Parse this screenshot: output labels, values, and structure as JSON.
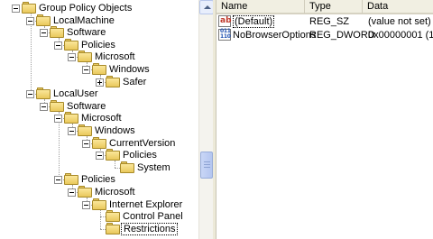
{
  "tree": {
    "nodes": [
      {
        "label": "Group Policy Objects",
        "level": 0,
        "expanded": true
      },
      {
        "label": "LocalMachine",
        "level": 1,
        "expanded": true
      },
      {
        "label": "Software",
        "level": 2,
        "expanded": true
      },
      {
        "label": "Policies",
        "level": 3,
        "expanded": true
      },
      {
        "label": "Microsoft",
        "level": 4,
        "expanded": true
      },
      {
        "label": "Windows",
        "level": 5,
        "expanded": true
      },
      {
        "label": "Safer",
        "level": 6,
        "expanded": false
      },
      {
        "label": "LocalUser",
        "level": 1,
        "expanded": true
      },
      {
        "label": "Software",
        "level": 2,
        "expanded": true
      },
      {
        "label": "Microsoft",
        "level": 3,
        "expanded": true
      },
      {
        "label": "Windows",
        "level": 4,
        "expanded": true
      },
      {
        "label": "CurrentVersion",
        "level": 5,
        "expanded": true
      },
      {
        "label": "Policies",
        "level": 6,
        "expanded": true
      },
      {
        "label": "System",
        "level": 7,
        "expanded": null
      },
      {
        "label": "Policies",
        "level": 3,
        "expanded": true
      },
      {
        "label": "Microsoft",
        "level": 4,
        "expanded": true
      },
      {
        "label": "Internet Explorer",
        "level": 5,
        "expanded": true
      },
      {
        "label": "Control Panel",
        "level": 6,
        "expanded": null
      },
      {
        "label": "Restrictions",
        "level": 6,
        "expanded": null,
        "selected": true
      }
    ]
  },
  "list": {
    "columns": {
      "name": "Name",
      "type": "Type",
      "data": "Data"
    },
    "rows": [
      {
        "icon": "string-value-icon",
        "icon_text": "ab",
        "name": "(Default)",
        "type": "REG_SZ",
        "data": "(value not set)"
      },
      {
        "icon": "binary-value-icon",
        "icon_text": "011 110",
        "name": "NoBrowserOptions",
        "type": "REG_DWORD",
        "data": "0x00000001 (1)"
      }
    ]
  },
  "colors": {
    "folder": "#f0d070",
    "header_bg": "#f1efe2",
    "scroll_thumb": "#c1d0f3"
  },
  "scrollbar": {
    "position_fraction": 0.62
  }
}
